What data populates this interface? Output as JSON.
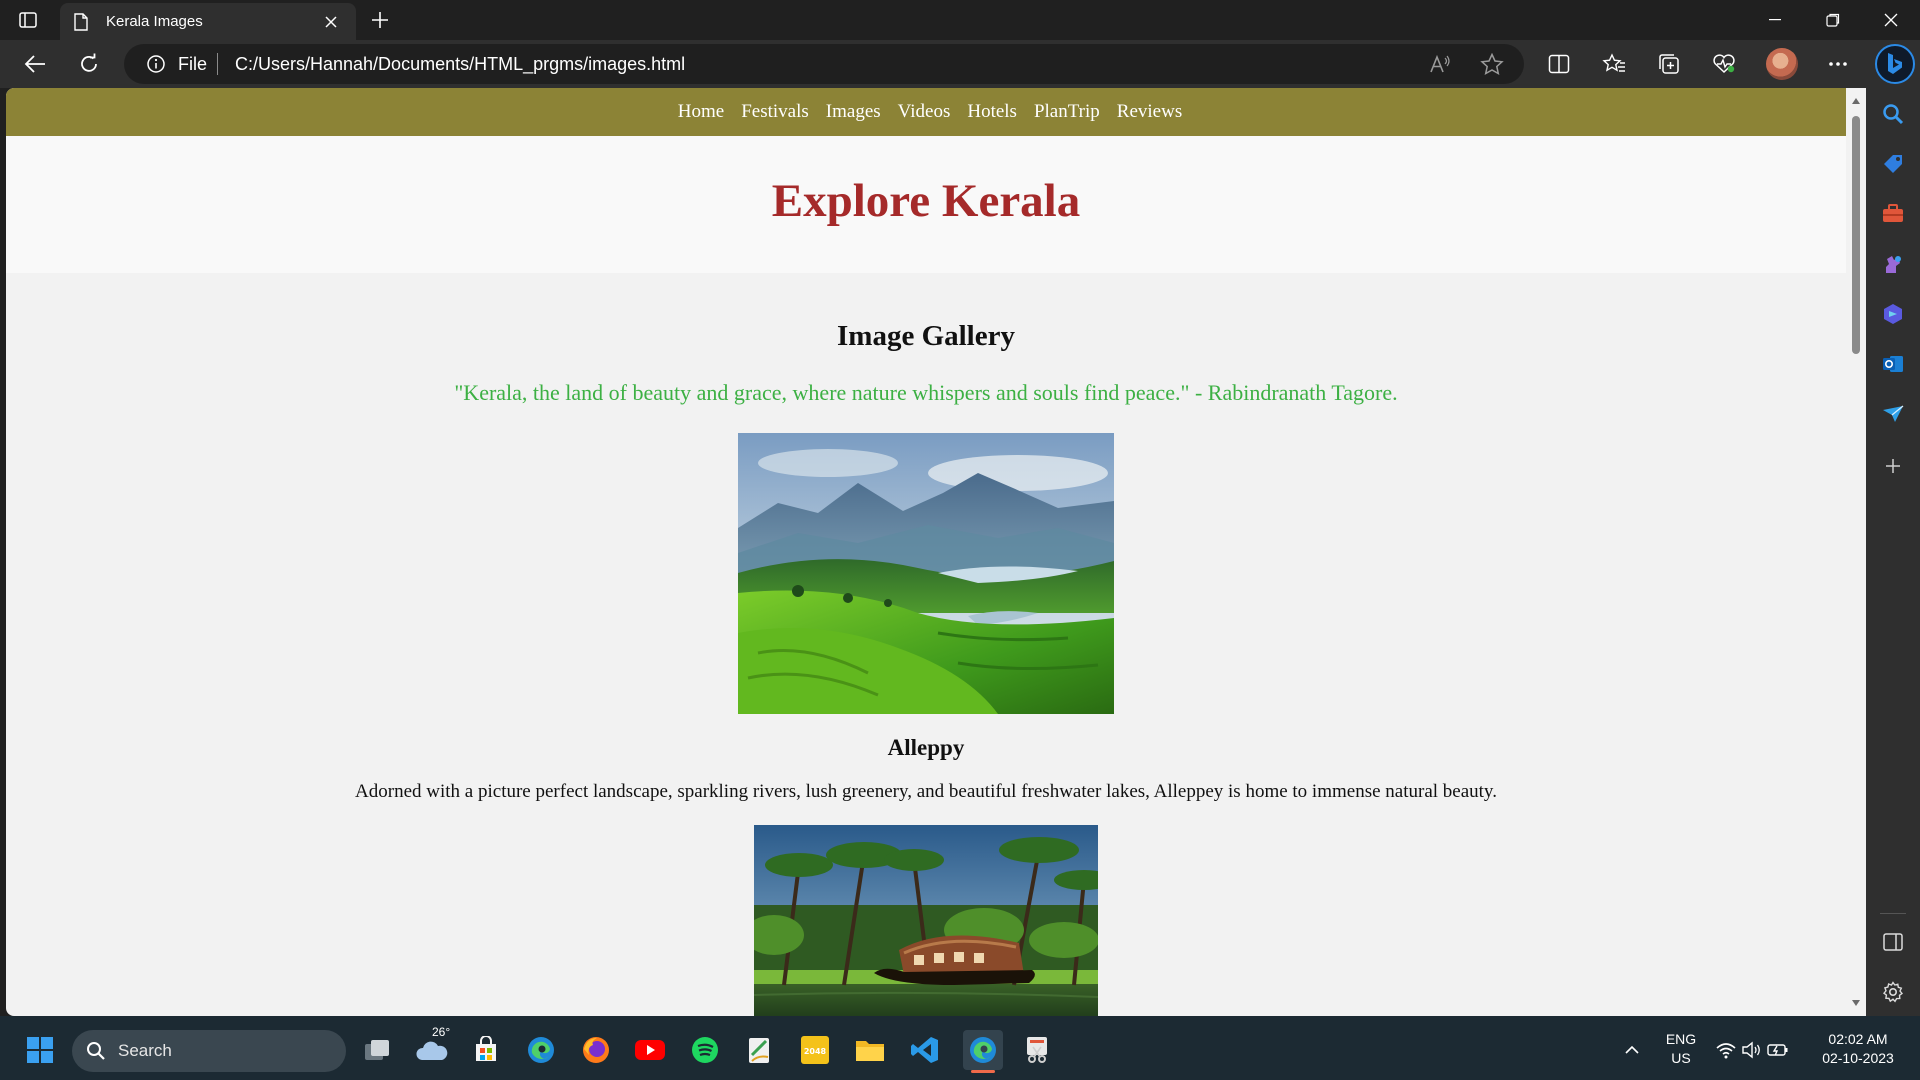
{
  "browser": {
    "tab_title": "Kerala Images",
    "address_scheme": "File",
    "address_url": "C:/Users/Hannah/Documents/HTML_prgms/images.html"
  },
  "page": {
    "nav": [
      "Home",
      "Festivals",
      "Images",
      "Videos",
      "Hotels",
      "PlanTrip",
      "Reviews"
    ],
    "title": "Explore Kerala",
    "gallery_title": "Image Gallery",
    "quote": "\"Kerala, the land of beauty and grace, where nature whispers and souls find peace.\" - Rabindranath Tagore.",
    "items": [
      {
        "caption": "Alleppy",
        "description": "Adorned with a picture perfect landscape, sparkling rivers, lush greenery, and beautiful freshwater lakes, Alleppey is home to immense natural beauty."
      }
    ],
    "colors": {
      "nav_bg": "#8c8336",
      "title": "#a52a2a",
      "quote": "#3cb043"
    }
  },
  "taskbar": {
    "search_placeholder": "Search",
    "weather_temp": "26°",
    "language_line1": "ENG",
    "language_line2": "US",
    "time": "02:02 AM",
    "date": "02-10-2023"
  },
  "icons": {
    "taskbar_apps": [
      "task-view-icon",
      "weather-icon",
      "microsoft-store-icon",
      "edge-icon",
      "firefox-icon",
      "youtube-icon",
      "spotify-icon",
      "notepad-icon",
      "game-2048-icon",
      "file-explorer-icon",
      "vscode-icon",
      "edge-active-icon",
      "snipping-tool-icon"
    ],
    "sidebar": [
      "search-icon",
      "shopping-icon",
      "tools-icon",
      "games-icon",
      "copilot-icon",
      "outlook-icon",
      "drop-icon",
      "add-icon"
    ]
  }
}
